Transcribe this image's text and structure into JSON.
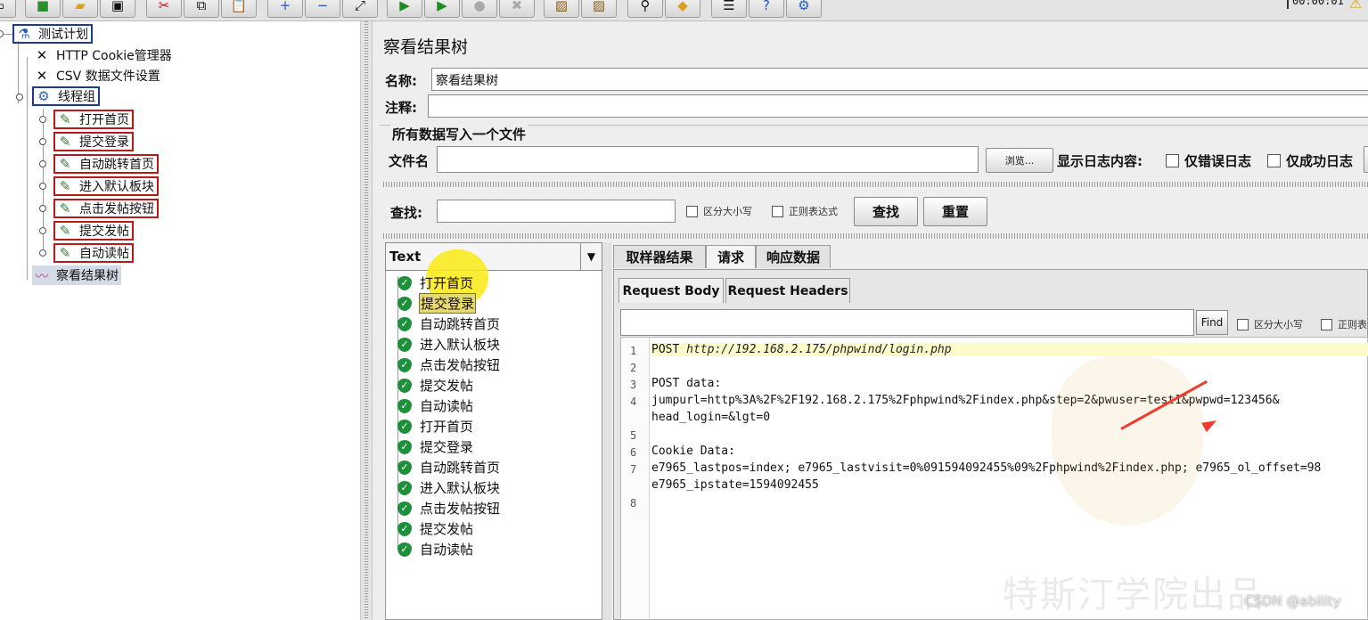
{
  "toolbar": {
    "timer": "00:00:01",
    "warn_icon": "warning-icon"
  },
  "tree": {
    "root": "测试计划",
    "items": [
      "HTTP Cookie管理器",
      "CSV 数据文件设置",
      "线程组",
      "打开首页",
      "提交登录",
      "自动跳转首页",
      "进入默认板块",
      "点击发帖按钮",
      "提交发帖",
      "自动读帖",
      "察看结果树"
    ]
  },
  "panel": {
    "title": "察看结果树",
    "name_label": "名称:",
    "name_value": "察看结果树",
    "comment_label": "注释:",
    "group_title": "所有数据写入一个文件",
    "file_label": "文件名",
    "browse_button": "浏览...",
    "log_label": "显示日志内容:",
    "errors_only": "仅错误日志",
    "success_only": "仅成功日志"
  },
  "search": {
    "label": "查找:",
    "case_sensitive": "区分大小写",
    "regex": "正则表达式",
    "find_button": "查找",
    "reset_button": "重置"
  },
  "results": {
    "renderer": "Text",
    "items": [
      "打开首页",
      "提交登录",
      "自动跳转首页",
      "进入默认板块",
      "点击发帖按钮",
      "提交发帖",
      "自动读帖",
      "打开首页",
      "提交登录",
      "自动跳转首页",
      "进入默认板块",
      "点击发帖按钮",
      "提交发帖",
      "自动读帖"
    ]
  },
  "tabs": [
    "取样器结果",
    "请求",
    "响应数据"
  ],
  "subtabs": [
    "Request Body",
    "Request Headers"
  ],
  "detail_search": {
    "find_button": "Find",
    "case_sensitive": "区分大小写",
    "regex": "正则表"
  },
  "code": {
    "line_numbers": [
      "1",
      "2",
      "3",
      "4",
      "5",
      "6",
      "7",
      "8"
    ],
    "line1_method": "POST ",
    "line1_url": "http://192.168.2.175/phpwind/login.php",
    "line3": "POST data:",
    "line4a": "jumpurl=http%3A%2F%2F192.168.2.175%2Fphpwind%2Findex.php&step=2&pwuser=test1&pwpwd=123456&",
    "line4b": "head_login=&lgt=0",
    "line6": "Cookie Data:",
    "line7a": "e7965_lastpos=index; e7965_lastvisit=0%091594092455%09%2Fphpwind%2Findex.php; e7965_ol_offset=98",
    "line7b": "e7965_ipstate=1594092455"
  },
  "watermark": "特斯汀学院出品",
  "csdn": "CSDN @ability"
}
